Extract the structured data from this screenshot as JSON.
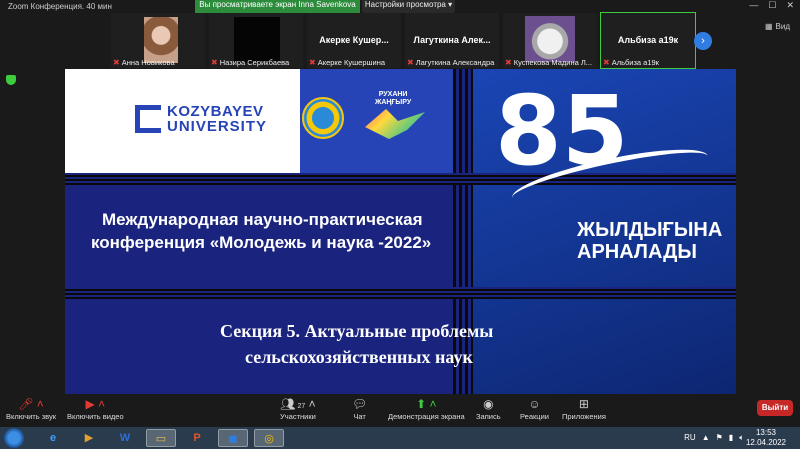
{
  "titlebar": {
    "app_title": "Zoom Конференция. 40 мин",
    "share_banner": "Вы просматриваете экран Inna Savenkova",
    "view_options": "Настройки просмотра ▾",
    "window_controls": [
      "—",
      "☐",
      "✕"
    ]
  },
  "gallery": {
    "label": "Вид",
    "participants": [
      {
        "caption": "Анна Новикова",
        "big_name": "",
        "muted": true
      },
      {
        "caption": "Назира Серикбаева",
        "big_name": "",
        "muted": true
      },
      {
        "caption": "Акерке Кушершина",
        "big_name": "Акерке Кушер...",
        "muted": true
      },
      {
        "caption": "Лагуткина Александра",
        "big_name": "Лагуткина Алек...",
        "muted": true
      },
      {
        "caption": "Куспекова Мадина Л...",
        "big_name": "",
        "muted": true
      },
      {
        "caption": "Альбиза а19к",
        "big_name": "Альбиза а19к",
        "muted": true
      }
    ],
    "next_icon": "›"
  },
  "slide": {
    "logo_line1": "KOZYBAYEV",
    "logo_line2": "UNIVERSITY",
    "rj_line1": "РУХАНИ",
    "rj_line2": "ЖАҢҒЫРУ",
    "big_number": "85",
    "anniv_line1": "ЖЫЛДЫҒЫНА",
    "anniv_line2": "АРНАЛАДЫ",
    "conf_line1": "Международная научно-практическая",
    "conf_line2": "конференция «Молодежь и наука -2022»",
    "section_line1": "Секция 5. Актуальные проблемы",
    "section_line2": "сельскохозяйственных наук"
  },
  "toolbar": {
    "mute": "Включить звук",
    "video": "Включить видео",
    "participants": "Участники",
    "participants_count": "27",
    "chat": "Чат",
    "share": "Демонстрация экрана",
    "record": "Запись",
    "reactions": "Реакции",
    "apps": "Приложения",
    "leave": "Выйти"
  },
  "taskbar": {
    "lang": "RU",
    "time": "13:53",
    "date": "12.04.2022"
  },
  "colors": {
    "zoom_green": "#2d8c3c",
    "slide_navy": "#1a237e",
    "leave_red": "#c62828",
    "taskbar": "#2b3b4e"
  }
}
